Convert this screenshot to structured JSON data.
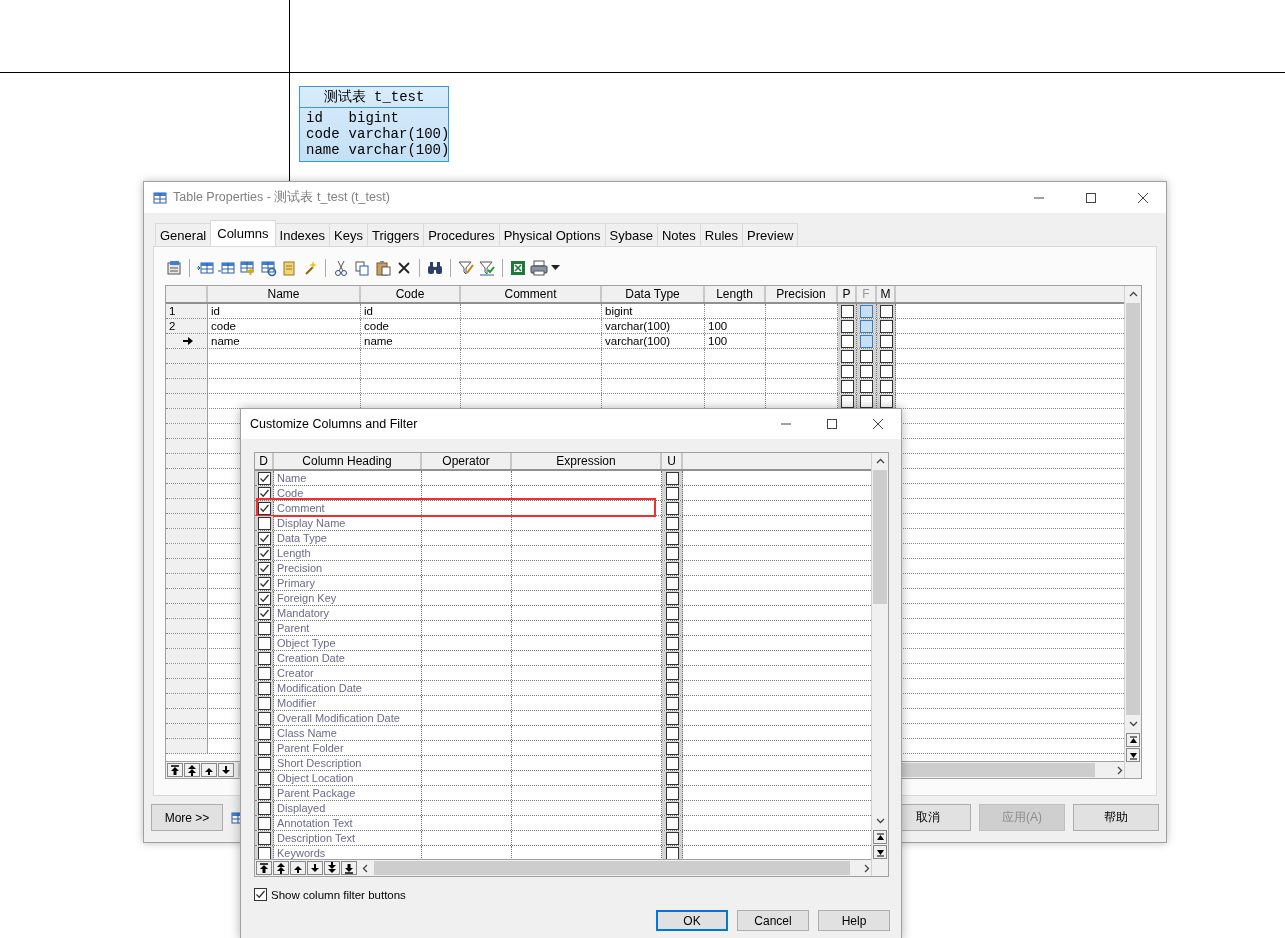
{
  "canvas": {
    "entity": {
      "title": "测试表 t_test",
      "columns": [
        {
          "name": "id",
          "type": "bigint"
        },
        {
          "name": "code",
          "type": "varchar(100)"
        },
        {
          "name": "name",
          "type": "varchar(100)"
        }
      ]
    }
  },
  "properties_window": {
    "title": "Table Properties - 测试表 t_test (t_test)",
    "tabs": [
      {
        "label": "General",
        "selected": false
      },
      {
        "label": "Columns",
        "selected": true
      },
      {
        "label": "Indexes",
        "selected": false
      },
      {
        "label": "Keys",
        "selected": false
      },
      {
        "label": "Triggers",
        "selected": false
      },
      {
        "label": "Procedures",
        "selected": false
      },
      {
        "label": "Physical Options",
        "selected": false
      },
      {
        "label": "Sybase",
        "selected": false
      },
      {
        "label": "Notes",
        "selected": false
      },
      {
        "label": "Rules",
        "selected": false
      },
      {
        "label": "Preview",
        "selected": false
      }
    ],
    "columns": [
      {
        "label": "Name",
        "disabled": false
      },
      {
        "label": "Code",
        "disabled": false
      },
      {
        "label": "Comment",
        "disabled": false
      },
      {
        "label": "Data Type",
        "disabled": false
      },
      {
        "label": "Length",
        "disabled": false
      },
      {
        "label": "Precision",
        "disabled": false
      },
      {
        "label": "P",
        "disabled": false
      },
      {
        "label": "F",
        "disabled": true
      },
      {
        "label": "M",
        "disabled": false
      }
    ],
    "rows": [
      {
        "number": "1",
        "current": false,
        "name": "id",
        "code": "id",
        "data_type": "bigint",
        "flags": [
          {
            "checked": false,
            "highlighted": false
          },
          {
            "checked": false,
            "highlighted": true
          },
          {
            "checked": false,
            "highlighted": false
          }
        ]
      },
      {
        "number": "2",
        "current": false,
        "name": "code",
        "code": "code",
        "data_type": "varchar(100)",
        "length": "100",
        "flags": [
          {
            "checked": false,
            "highlighted": false
          },
          {
            "checked": false,
            "highlighted": true
          },
          {
            "checked": false,
            "highlighted": false
          }
        ]
      },
      {
        "current": true,
        "name": "name",
        "code": "name",
        "data_type": "varchar(100)",
        "length": "100",
        "flags": [
          {
            "checked": false,
            "highlighted": false
          },
          {
            "checked": false,
            "highlighted": true
          },
          {
            "checked": false,
            "highlighted": false
          }
        ]
      },
      {
        "current": false,
        "flags": [
          {
            "checked": false,
            "highlighted": false
          },
          {
            "checked": false,
            "highlighted": false
          },
          {
            "checked": false,
            "highlighted": false
          }
        ]
      },
      {
        "current": false,
        "flags": [
          {
            "checked": false,
            "highlighted": false
          },
          {
            "checked": false,
            "highlighted": false
          },
          {
            "checked": false,
            "highlighted": false
          }
        ]
      },
      {
        "current": false,
        "flags": [
          {
            "checked": false,
            "highlighted": false
          },
          {
            "checked": false,
            "highlighted": false
          },
          {
            "checked": false,
            "highlighted": false
          }
        ]
      },
      {
        "current": false,
        "flags": [
          {
            "checked": false,
            "highlighted": false
          },
          {
            "checked": false,
            "highlighted": false
          },
          {
            "checked": false,
            "highlighted": false
          }
        ]
      }
    ],
    "buttons": [
      {
        "label": "More >>",
        "kind": "expander",
        "disabled": false
      },
      {
        "label": "取消",
        "kind": "action",
        "disabled": false
      },
      {
        "label": "应用(A)",
        "kind": "action",
        "disabled": true
      },
      {
        "label": "帮助",
        "kind": "action",
        "disabled": false
      }
    ]
  },
  "customize_dialog": {
    "title": "Customize Columns and Filter",
    "columns": [
      "D",
      "Column Heading",
      "Operator",
      "Expression",
      "U"
    ],
    "rows": [
      {
        "heading": "Name",
        "displayed": true,
        "unique": false,
        "highlighted": false
      },
      {
        "heading": "Code",
        "displayed": true,
        "unique": false,
        "highlighted": false
      },
      {
        "heading": "Comment",
        "displayed": true,
        "unique": false,
        "highlighted": true
      },
      {
        "heading": "Display Name",
        "displayed": false,
        "unique": false,
        "highlighted": false
      },
      {
        "heading": "Data Type",
        "displayed": true,
        "unique": false,
        "highlighted": false
      },
      {
        "heading": "Length",
        "displayed": true,
        "unique": false,
        "highlighted": false
      },
      {
        "heading": "Precision",
        "displayed": true,
        "unique": false,
        "highlighted": false
      },
      {
        "heading": "Primary",
        "displayed": true,
        "unique": false,
        "highlighted": false
      },
      {
        "heading": "Foreign Key",
        "displayed": true,
        "unique": false,
        "highlighted": false
      },
      {
        "heading": "Mandatory",
        "displayed": true,
        "unique": false,
        "highlighted": false
      },
      {
        "heading": "Parent",
        "displayed": false,
        "unique": false,
        "highlighted": false
      },
      {
        "heading": "Object Type",
        "displayed": false,
        "unique": false,
        "highlighted": false
      },
      {
        "heading": "Creation Date",
        "displayed": false,
        "unique": false,
        "highlighted": false
      },
      {
        "heading": "Creator",
        "displayed": false,
        "unique": false,
        "highlighted": false
      },
      {
        "heading": "Modification Date",
        "displayed": false,
        "unique": false,
        "highlighted": false
      },
      {
        "heading": "Modifier",
        "displayed": false,
        "unique": false,
        "highlighted": false
      },
      {
        "heading": "Overall Modification Date",
        "displayed": false,
        "unique": false,
        "highlighted": false
      },
      {
        "heading": "Class Name",
        "displayed": false,
        "unique": false,
        "highlighted": false
      },
      {
        "heading": "Parent Folder",
        "displayed": false,
        "unique": false,
        "highlighted": false
      },
      {
        "heading": "Short Description",
        "displayed": false,
        "unique": false,
        "highlighted": false
      },
      {
        "heading": "Object Location",
        "displayed": false,
        "unique": false,
        "highlighted": false
      },
      {
        "heading": "Parent Package",
        "displayed": false,
        "unique": false,
        "highlighted": false
      },
      {
        "heading": "Displayed",
        "displayed": false,
        "unique": false,
        "highlighted": false
      },
      {
        "heading": "Annotation Text",
        "displayed": false,
        "unique": false,
        "highlighted": false
      },
      {
        "heading": "Description Text",
        "displayed": false,
        "unique": false,
        "highlighted": false
      },
      {
        "heading": "Keywords",
        "displayed": false,
        "unique": false,
        "highlighted": false
      }
    ],
    "show_filter_buttons": {
      "label": "Show column filter buttons",
      "checked": true
    },
    "buttons": [
      {
        "label": "OK",
        "default": true
      },
      {
        "label": "Cancel",
        "default": false
      },
      {
        "label": "Help",
        "default": false
      }
    ]
  }
}
